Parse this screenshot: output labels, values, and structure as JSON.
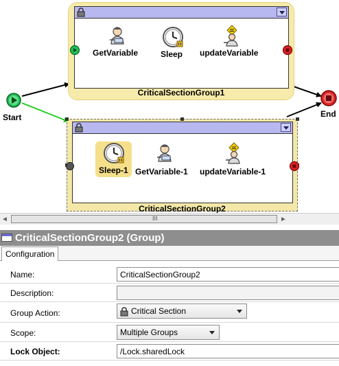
{
  "canvas": {
    "start": {
      "label": "Start"
    },
    "end": {
      "label": "End"
    },
    "group1": {
      "label": "CriticalSectionGroup1",
      "nodes": [
        {
          "label": "GetVariable",
          "icon": "service-person-icon"
        },
        {
          "label": "Sleep",
          "icon": "clock-icon"
        },
        {
          "label": "updateVariable",
          "icon": "update-person-icon"
        }
      ]
    },
    "group2": {
      "label": "CriticalSectionGroup2",
      "nodes": [
        {
          "label": "Sleep-1",
          "icon": "clock-icon"
        },
        {
          "label": "GetVariable-1",
          "icon": "service-person-icon"
        },
        {
          "label": "updateVariable-1",
          "icon": "update-person-icon"
        }
      ]
    },
    "colors": {
      "group_fill": "#f6ebaa",
      "titlebar": "#b8b8f0",
      "active_wire": "#22cc22",
      "end_red": "#dd2222",
      "start_green": "#22bb55"
    }
  },
  "scrollbar": {
    "grip": "III"
  },
  "properties": {
    "title": "CriticalSectionGroup2 (Group)",
    "tabs": [
      "Configuration"
    ],
    "fields": {
      "name": {
        "label": "Name:",
        "value": "CriticalSectionGroup2"
      },
      "description": {
        "label": "Description:",
        "value": ""
      },
      "group_action": {
        "label": "Group Action:",
        "value": "Critical Section"
      },
      "scope": {
        "label": "Scope:",
        "value": "Multiple Groups"
      },
      "lock_object": {
        "label": "Lock Object:",
        "value": "/Lock.sharedLock"
      }
    }
  }
}
